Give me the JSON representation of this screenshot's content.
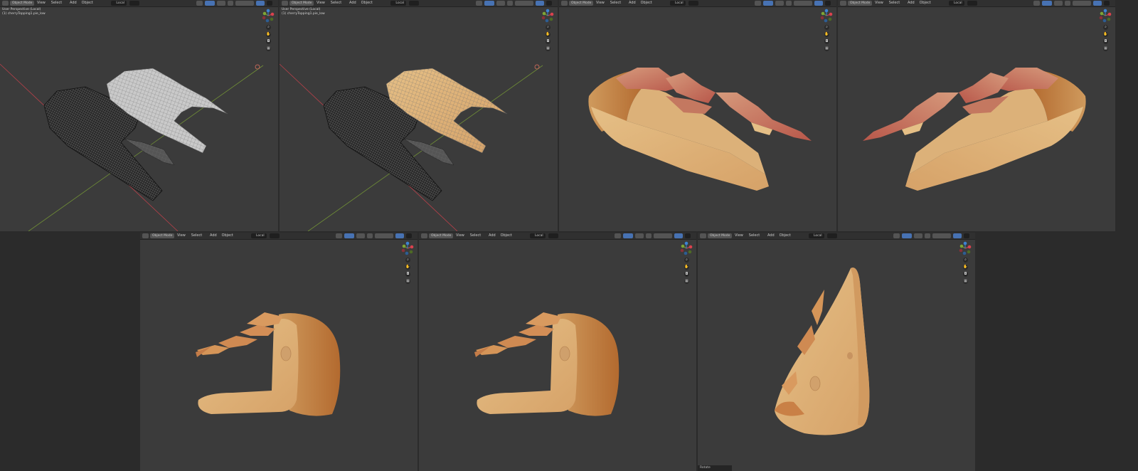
{
  "app": "Blender",
  "header": {
    "mode_label": "Object Mode",
    "menu": [
      "View",
      "Select",
      "Add",
      "Object"
    ],
    "transform_space": "Local"
  },
  "viewports": [
    {
      "id": "v1",
      "info_line1": "User Perspective (Local)",
      "info_line2": "(1) cherryTopping1.pie_low",
      "show_info": true,
      "shading": "wireframe-dual"
    },
    {
      "id": "v2",
      "info_line1": "User Perspective (Local)",
      "info_line2": "(1) cherryTopping1.pie_low",
      "show_info": true,
      "shading": "wireframe-textured"
    },
    {
      "id": "v3",
      "shading": "textured"
    },
    {
      "id": "v4",
      "shading": "textured"
    },
    {
      "id": "v5",
      "shading": "textured-front"
    },
    {
      "id": "v6",
      "shading": "textured-front"
    },
    {
      "id": "v7",
      "shading": "textured-side",
      "status": "Rotate"
    }
  ],
  "icons": {
    "axis_x_color": "#d9424e",
    "axis_y_color": "#7ea535",
    "axis_z_color": "#3d83d1",
    "nav": [
      "zoom-icon",
      "hand-pan-icon",
      "camera-icon",
      "grid-icon"
    ]
  },
  "colors": {
    "viewport_bg": "#3b3b3b",
    "crust_light": "#e5bf86",
    "crust_dark": "#b36a2f",
    "filling": "#b8574a",
    "wire_dark": "#1c1c1c",
    "wire_light": "#d8d8d8"
  }
}
